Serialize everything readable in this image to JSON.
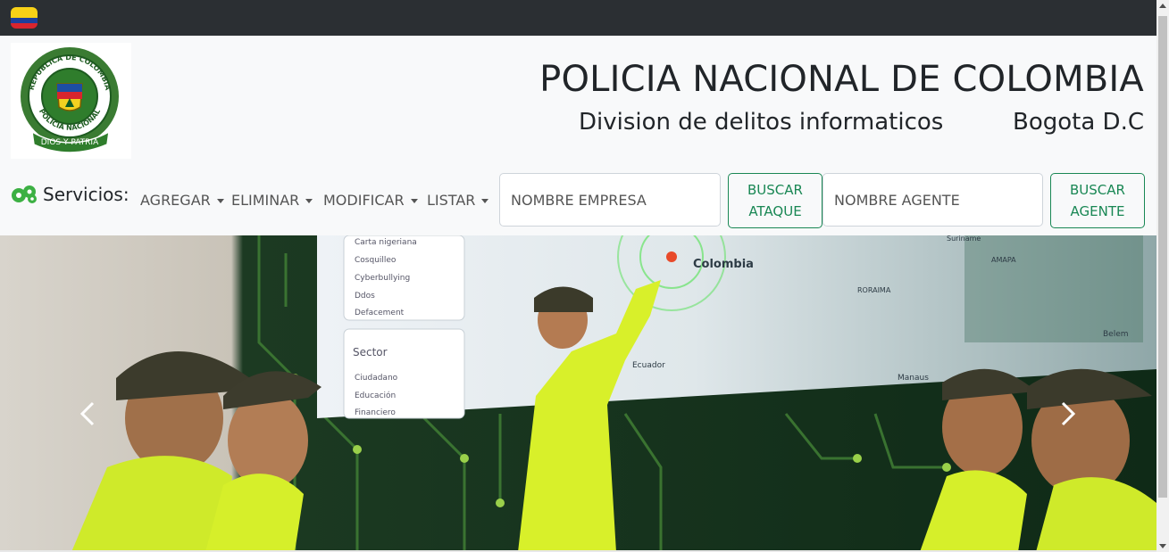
{
  "header": {
    "title": "POLICIA NACIONAL DE COLOMBIA",
    "subtitle": "Division de delitos informaticos",
    "city": "Bogota D.C",
    "logo_text_top": "REPUBLICA DE COLOMBIA",
    "logo_text_bottom": "POLICIA NACIONAL",
    "logo_motto": "DIOS Y PATRIA"
  },
  "nav": {
    "services_label": "Servicios:",
    "menus": [
      "AGREGAR",
      "ELIMINAR",
      "MODIFICAR",
      "LISTAR"
    ],
    "company_placeholder": "NOMBRE EMPRESA",
    "attack_button": [
      "BUSCAR",
      "ATAQUE"
    ],
    "agent_placeholder": "NOMBRE AGENTE",
    "agent_button": [
      "BUSCAR",
      "AGENTE"
    ]
  },
  "carousel": {
    "screen_list_items": [
      "Carta nigeriana",
      "Cosquilleo",
      "Cyberbullying",
      "Ddos",
      "Defacement"
    ],
    "sector_title": "Sector",
    "sector_items": [
      "Ciudadano",
      "Educación",
      "Financiero"
    ],
    "map_labels": [
      "Colombia",
      "Ecuador",
      "RORAIMA",
      "AMAPA",
      "Manaus",
      "Belem",
      "Suriname"
    ]
  },
  "colors": {
    "topbar": "#2b2f33",
    "accent": "#198754",
    "text": "#212529"
  }
}
